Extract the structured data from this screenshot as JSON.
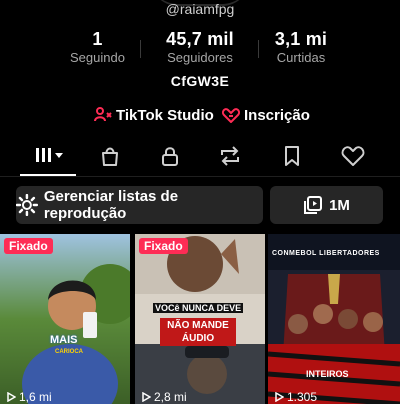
{
  "profile": {
    "handle": "@raiamfpg",
    "bio": "CfGW3E"
  },
  "stats": [
    {
      "value": "1",
      "label": "Seguindo"
    },
    {
      "value": "45,7 mil",
      "label": "Seguidores"
    },
    {
      "value": "3,1 mi",
      "label": "Curtidas"
    }
  ],
  "links": [
    {
      "label": "TikTok Studio",
      "icon": "tiktok-studio-icon"
    },
    {
      "label": "Inscrição",
      "icon": "subscription-icon"
    }
  ],
  "tabs": [
    {
      "icon": "grid-icon",
      "selected": true
    },
    {
      "icon": "shop-bag-icon"
    },
    {
      "icon": "lock-icon"
    },
    {
      "icon": "repost-icon"
    },
    {
      "icon": "bookmark-icon"
    },
    {
      "icon": "heart-icon"
    }
  ],
  "actions": {
    "playlists_label": "Gerenciar listas de reprodução",
    "playlist_views": "1M"
  },
  "videos": [
    {
      "pinned_label": "Fixado",
      "views": "1,6 mi",
      "overlay_text": "MAIS",
      "overlay_sub": "CARIOCA"
    },
    {
      "pinned_label": "Fixado",
      "views": "2,8 mi",
      "overlay_text": "VOCê NUNCA DEVE",
      "overlay_box": "NÃO MANDE ÁUDIO"
    },
    {
      "views": "1.305",
      "header_text": "CONMEBOL LIBERTADORES",
      "overlay_text": "INTEIROS"
    }
  ],
  "colors": {
    "background": "#000000",
    "accent": "#fe2c55",
    "secondary_text": "#a6a6a6",
    "button_bg": "#262626"
  }
}
